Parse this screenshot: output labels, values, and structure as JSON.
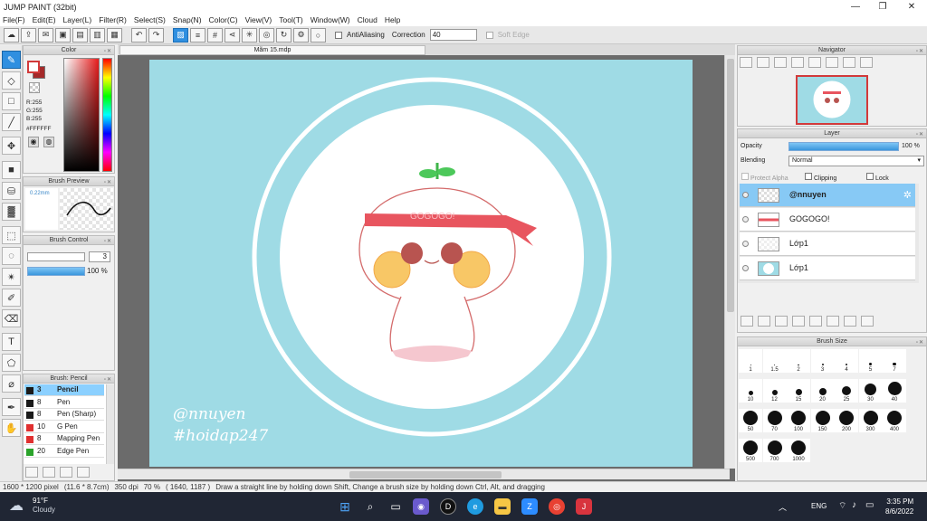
{
  "window": {
    "title": "JUMP PAINT (32bit)"
  },
  "menu": [
    "File(F)",
    "Edit(E)",
    "Layer(L)",
    "Filter(R)",
    "Select(S)",
    "Snap(N)",
    "Color(C)",
    "View(V)",
    "Tool(T)",
    "Window(W)",
    "Cloud",
    "Help"
  ],
  "toolbar": {
    "antialiasing_label": "AntiAliasing",
    "correction_label": "Correction",
    "correction_value": "40",
    "soft_edge_label": "Soft Edge"
  },
  "color_panel": {
    "title": "Color",
    "r": "R:255",
    "g": "G:255",
    "b": "B:255",
    "hex": "#FFFFFF"
  },
  "brush_preview": {
    "title": "Brush Preview",
    "size": "0.22mm"
  },
  "brush_control": {
    "title": "Brush Control",
    "size_value": "3",
    "opacity_value": "100 %",
    "opacity_fill": 1.0
  },
  "brush_list": {
    "title": "Brush: Pencil",
    "items": [
      {
        "size": "3",
        "name": "Pencil",
        "color": "#1a1a1a",
        "selected": true
      },
      {
        "size": "8",
        "name": "Pen",
        "color": "#1a1a1a"
      },
      {
        "size": "8",
        "name": "Pen (Sharp)",
        "color": "#1a1a1a"
      },
      {
        "size": "10",
        "name": "G Pen",
        "color": "#e03030"
      },
      {
        "size": "8",
        "name": "Mapping Pen",
        "color": "#e03030"
      },
      {
        "size": "20",
        "name": "Edge Pen",
        "color": "#2aa32a"
      }
    ]
  },
  "document": {
    "tab_title": "Mãm 15.mdp"
  },
  "artwork": {
    "bubble_text": "GOGOGO!",
    "watermark_line1": "@nnuyen",
    "watermark_line2": "#hoidap247"
  },
  "navigator": {
    "title": "Navigator"
  },
  "layer_panel": {
    "title": "Layer",
    "opacity_label": "Opacity",
    "opacity_value": "100 %",
    "opacity_fill": 1.0,
    "blending_label": "Blending",
    "blending_value": "Normal",
    "protect_alpha": "Protect Alpha",
    "clipping": "Clipping",
    "lock": "Lock",
    "layers": [
      {
        "name": "@nnuyen",
        "selected": true
      },
      {
        "name": "GOGOGO!"
      },
      {
        "name": "Lớp1"
      },
      {
        "name": "Lớp1"
      }
    ]
  },
  "brush_size": {
    "title": "Brush Size",
    "sizes": [
      "1",
      "1.5",
      "2",
      "3",
      "4",
      "5",
      "7",
      "10",
      "12",
      "15",
      "20",
      "25",
      "30",
      "40",
      "50",
      "70",
      "100",
      "150",
      "200",
      "300",
      "400",
      "500",
      "700",
      "1000"
    ]
  },
  "status": {
    "dimensions": "1600 * 1200 pixel",
    "physical": "(11.6 * 8.7cm)",
    "dpi": "350 dpi",
    "zoom": "70 %",
    "cursor": "( 1640, 1187 )",
    "hint": "Draw a straight line by holding down Shift, Change a brush size by holding down Ctrl, Alt, and dragging"
  },
  "taskbar": {
    "temperature": "91°F",
    "weather": "Cloudy",
    "lang": "ENG",
    "time": "3:35 PM",
    "date": "8/6/2022"
  }
}
